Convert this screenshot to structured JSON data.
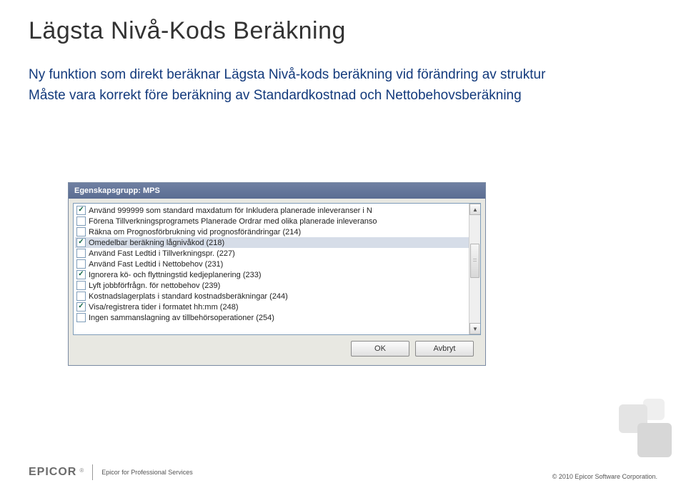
{
  "title": "Lägsta Nivå-Kods Beräkning",
  "bullets": {
    "line1": "Ny funktion som direkt beräknar Lägsta Nivå-kods beräkning vid förändring av struktur",
    "line2": "Måste vara korrekt före beräkning av Standardkostnad och Nettobehovsberäkning"
  },
  "dialog": {
    "title": "Egenskapsgrupp: MPS",
    "options": [
      {
        "checked": true,
        "selected": false,
        "label": "Använd 999999 som standard maxdatum för Inkludera planerade inleveranser i N"
      },
      {
        "checked": false,
        "selected": false,
        "label": "Förena Tillverkningsprogramets Planerade Ordrar med olika planerade inleveranso"
      },
      {
        "checked": false,
        "selected": false,
        "label": "Räkna om Prognosförbrukning vid prognosförändringar (214)"
      },
      {
        "checked": true,
        "selected": true,
        "label": "Omedelbar beräkning lågnivåkod (218)"
      },
      {
        "checked": false,
        "selected": false,
        "label": "Använd Fast Ledtid i Tillverkningspr. (227)"
      },
      {
        "checked": false,
        "selected": false,
        "label": "Använd Fast Ledtid i Nettobehov (231)"
      },
      {
        "checked": true,
        "selected": false,
        "label": "Ignorera kö- och flyttningstid kedjeplanering (233)"
      },
      {
        "checked": false,
        "selected": false,
        "label": "Lyft jobbförfrågn. för nettobehov (239)"
      },
      {
        "checked": false,
        "selected": false,
        "label": "Kostnadslagerplats i standard kostnadsberäkningar (244)"
      },
      {
        "checked": true,
        "selected": false,
        "label": "Visa/registrera tider i formatet hh:mm (248)"
      },
      {
        "checked": false,
        "selected": false,
        "label": "Ingen sammanslagning av tillbehörsoperationer (254)"
      }
    ],
    "buttons": {
      "ok": "OK",
      "cancel": "Avbryt"
    }
  },
  "footer": {
    "logo": "EPICOR",
    "reg": "®",
    "tagline": "Epicor for Professional Services",
    "copyright": "© 2010 Epicor Software Corporation."
  }
}
